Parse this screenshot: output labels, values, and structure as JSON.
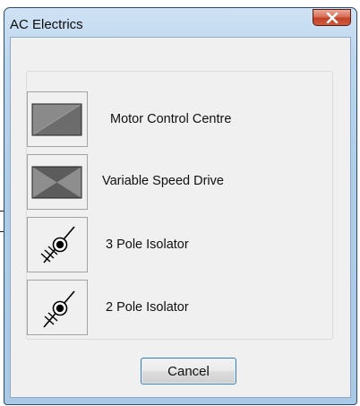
{
  "window": {
    "title": "AC Electrics"
  },
  "items": [
    {
      "label": "Motor Control Centre",
      "icon": "motor-control-centre-icon"
    },
    {
      "label": "Variable Speed Drive",
      "icon": "variable-speed-drive-icon"
    },
    {
      "label": "3 Pole Isolator",
      "icon": "3-pole-isolator-icon"
    },
    {
      "label": "2 Pole Isolator",
      "icon": "2-pole-isolator-icon"
    }
  ],
  "buttons": {
    "cancel": "Cancel"
  },
  "colors": {
    "title_gradient_top": "#cfe2f4",
    "close_red": "#c2422a",
    "dialog_bg": "#f0f0f0",
    "button_focus_border": "#3c7fb1"
  }
}
